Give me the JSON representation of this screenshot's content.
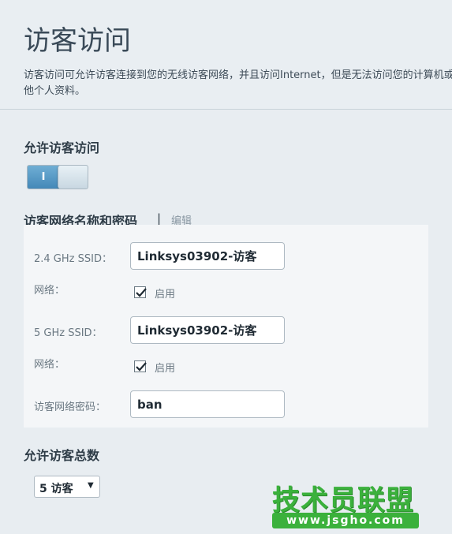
{
  "header": {
    "title": "访客访问",
    "description": "访客访问可允许访客连接到您的无线访客网络，并且访问Internet，但是无法访问您的计算机或其他个人资料。"
  },
  "allow_guest_access": {
    "title": "允许访客访问",
    "toggle": {
      "on_label": "I",
      "state": "on"
    }
  },
  "network": {
    "title": "访客网络名称和密码",
    "separator": "|",
    "edit_label": "编辑",
    "ssid_24": {
      "label": "2.4 GHz SSID：",
      "value": "Linksys03902-访客"
    },
    "network_24": {
      "label": "网络：",
      "checkbox_label": "启用",
      "checked": true
    },
    "ssid_5": {
      "label": "5 GHz SSID：",
      "value": "Linksys03902-访客"
    },
    "network_5": {
      "label": "网络：",
      "checkbox_label": "启用",
      "checked": true
    },
    "password": {
      "label": "访客网络密码：",
      "value": "ban"
    }
  },
  "max_guests": {
    "title": "允许访客总数",
    "selected": "5 访客",
    "arrow": "▼"
  },
  "watermark": {
    "text": "技术员联盟",
    "url": "www.jsgho.com"
  },
  "colors": {
    "toggle_on": "#4f93c1",
    "watermark_green": "#3bb13c",
    "panel_bg": "#f4f6f8"
  }
}
